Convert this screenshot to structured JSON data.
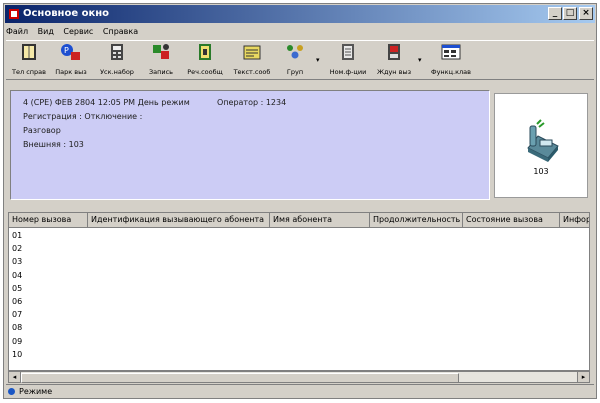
{
  "window": {
    "title": "Основное окно"
  },
  "menu": [
    "Файл",
    "Вид",
    "Сервис",
    "Справка"
  ],
  "toolbar": [
    {
      "label": "Тел справ",
      "icon": "phonebook-icon"
    },
    {
      "label": "Парк выз",
      "icon": "call-park-icon"
    },
    {
      "label": "Уск.набор",
      "icon": "speed-dial-icon"
    },
    {
      "label": "Запись",
      "icon": "record-icon"
    },
    {
      "label": "Реч.сообщ",
      "icon": "voice-message-icon"
    },
    {
      "label": "Текст.сооб",
      "icon": "text-message-icon"
    },
    {
      "label": "Груп",
      "icon": "group-icon"
    },
    {
      "label": "Ном.ф-ции",
      "icon": "function-number-icon"
    },
    {
      "label": "Ждун выз",
      "icon": "call-waiting-icon"
    },
    {
      "label": "Функц.клав",
      "icon": "function-keys-icon"
    }
  ],
  "info": {
    "line1": "4 (CPE) ФЕВ 2804 12:05 PM День режим",
    "operator": "Оператор : 1234",
    "line2": "Регистрация : Отключение :",
    "line3": "Разговор",
    "line4": "Внешняя : 103"
  },
  "phone": {
    "number": "103"
  },
  "table": {
    "columns": [
      "Номер вызова",
      "Идентификация вызывающего абонента",
      "Имя абонента",
      "Продолжительность",
      "Состояние вызова",
      "Информ"
    ],
    "rows": [
      "01",
      "02",
      "03",
      "04",
      "05",
      "06",
      "07",
      "08",
      "09",
      "10"
    ]
  },
  "status": {
    "mode": "Режиме"
  }
}
